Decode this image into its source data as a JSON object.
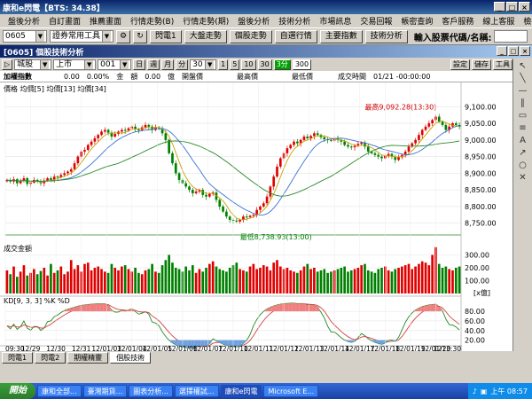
{
  "app": {
    "title": "康和e閃電【BTS: 34.38】",
    "window_buttons": [
      "_",
      "□",
      "×"
    ]
  },
  "menu": [
    "盤後分析",
    "自訂畫面",
    "推薦畫面",
    "行情走勢(B)",
    "行情走勢(期)",
    "盤後分析",
    "技術分析",
    "市場訊息",
    "交易回報",
    "帳密查詢",
    "客戶服務",
    "線上客服",
    "檢視說明"
  ],
  "toolbar": {
    "code_combo": "0605",
    "tool_combo": "證券常用工具",
    "buttons": [
      "閃電1",
      "大盤走勢",
      "個股走勢",
      "自選行情",
      "主要指數",
      "技術分析"
    ],
    "stock_input_label": "輸入股票代碼/名稱:"
  },
  "subwindow": {
    "title": "[0605] 個股技術分析",
    "buttons": [
      "_",
      "□",
      "×"
    ]
  },
  "controls": {
    "play_icon": "▷",
    "market_combo": "城股",
    "exchange_combo": "上市",
    "code_combo": "001",
    "period_buttons": [
      "日",
      "週",
      "月",
      "分"
    ],
    "period_value": "30",
    "minute_buttons": [
      "1",
      "5",
      "10",
      "30"
    ],
    "active_button": "3分",
    "count_value": "300",
    "right_buttons": [
      "設定",
      "儲存",
      "工具"
    ]
  },
  "info": {
    "index_label": "加權指數",
    "change": "0.00",
    "change_pct": "0.00%",
    "amount_label": "金　額",
    "amount": "0.00",
    "amount_unit": "億",
    "open_label": "開盤價",
    "high_label": "最高價",
    "low_label": "最低價",
    "time_label": "成交時間",
    "time_value": "01/21 -00:00:00"
  },
  "chart_data": [
    {
      "type": "candlestick",
      "title": "價格 均價[5] 均價[13] 均價[34]",
      "legend": [
        "均價[5]",
        "均價[13]",
        "均價[34]"
      ],
      "ma_colors": [
        "#c8a000",
        "#3a70d0",
        "#2a8a2a"
      ],
      "ylim": [
        8720,
        9130
      ],
      "yticks": [
        8750,
        8800,
        8850,
        8900,
        8950,
        9000,
        9050,
        9100
      ],
      "ytick_labels": [
        "8,750.00",
        "8,800.00",
        "8,850.00",
        "8,900.00",
        "8,950.00",
        "9,000.00",
        "9,050.00",
        "9,100.00"
      ],
      "annotations": {
        "high": "最高9,092.28(13:30)",
        "low": "最低8,738.93(13:00)"
      },
      "close": [
        8880,
        8875,
        8882,
        8870,
        8878,
        8885,
        8868,
        8872,
        8880,
        8876,
        8870,
        8878,
        8885,
        8880,
        8890,
        8888,
        8895,
        8900,
        8905,
        8912,
        8930,
        8950,
        8965,
        8970,
        8985,
        8995,
        9005,
        9015,
        9025,
        9030,
        9022,
        9010,
        9018,
        9025,
        9030,
        9028,
        9035,
        9040,
        9032,
        9030,
        9038,
        9045,
        9040,
        9030,
        9038,
        9035,
        9020,
        9000,
        8960,
        8930,
        8900,
        8880,
        8870,
        8860,
        8850,
        8840,
        8845,
        8850,
        8835,
        8830,
        8838,
        8842,
        8820,
        8800,
        8785,
        8770,
        8760,
        8758,
        8755,
        8760,
        8770,
        8768,
        8772,
        8775,
        8790,
        8800,
        8810,
        8830,
        8860,
        8890,
        8920,
        8945,
        8960,
        8975,
        8985,
        8995,
        8990,
        9000,
        9010,
        9005,
        9012,
        9020,
        9015,
        9008,
        9002,
        9000,
        8998,
        9005,
        9000,
        8995,
        8985,
        8980,
        8978,
        8982,
        8988,
        8992,
        8980,
        8965,
        8960,
        8955,
        8950,
        8945,
        8952,
        8958,
        8950,
        8940,
        8948,
        8955,
        8965,
        8980,
        8990,
        9000,
        9015,
        9030,
        9040,
        9050,
        9060,
        9070,
        9055,
        9045,
        9030,
        9040,
        9050,
        9045,
        9040
      ]
    },
    {
      "type": "bar",
      "title": "成交金額",
      "unit": "[x億]",
      "ylim": [
        0,
        400
      ],
      "yticks": [
        100,
        200,
        300
      ],
      "ytick_labels": [
        "100.00",
        "200.00",
        "300.00"
      ],
      "values": [
        180,
        150,
        210,
        130,
        170,
        220,
        140,
        160,
        190,
        150,
        175,
        200,
        140,
        230,
        160,
        180,
        210,
        150,
        170,
        260,
        190,
        220,
        170,
        230,
        240,
        180,
        200,
        210,
        190,
        170,
        160,
        230,
        200,
        180,
        210,
        220,
        190,
        170,
        200,
        160,
        150,
        180,
        190,
        230,
        170,
        160,
        220,
        260,
        300,
        240,
        200,
        190,
        170,
        210,
        180,
        220,
        160,
        190,
        170,
        200,
        230,
        250,
        210,
        190,
        180,
        170,
        200,
        220,
        240,
        190,
        180,
        170,
        210,
        230,
        190,
        200,
        220,
        210,
        180,
        240,
        260,
        210,
        190,
        200,
        180,
        170,
        160,
        180,
        210,
        230,
        190,
        200,
        170,
        180,
        190,
        160,
        170,
        180,
        190,
        200,
        210,
        170,
        180,
        190,
        200,
        220,
        230,
        180,
        170,
        160,
        190,
        200,
        210,
        180,
        170,
        190,
        200,
        210,
        220,
        230,
        190,
        210,
        230,
        250,
        240,
        220,
        300,
        360,
        230,
        200,
        210,
        190,
        180,
        200,
        210
      ]
    },
    {
      "type": "line",
      "title": "KD[9, 3, 3] %K %D",
      "series_colors": [
        "#228b22",
        "#d04040"
      ],
      "ylim": [
        10,
        95
      ],
      "yticks": [
        20,
        40,
        60,
        80
      ],
      "ytick_labels": [
        "20.00",
        "40.00",
        "60.00",
        "80.00"
      ]
    }
  ],
  "xaxis": {
    "labels": [
      "09:30",
      "12/29",
      "12/30",
      "12/31",
      "12/01/03",
      "12/01/04",
      "12/01/05",
      "12/01/06",
      "12/01/07",
      "12/01/10",
      "12/01/11",
      "12/01/12",
      "12/01/13",
      "12/01/14",
      "12/01/17",
      "12/01/18",
      "12/01/19",
      "12/01/20",
      "1213:30"
    ]
  },
  "bottom_tabs": [
    "閃電1",
    "閃電2",
    "期權精靈",
    "個股技術"
  ],
  "taskbar": {
    "start": "開始",
    "tasks": [
      "康和全部...",
      "臺灣期貨...",
      "圖表分析...",
      "選擇權試...",
      "康和e閃電",
      "Microsoft E..."
    ],
    "clock": "上午 08:57"
  }
}
